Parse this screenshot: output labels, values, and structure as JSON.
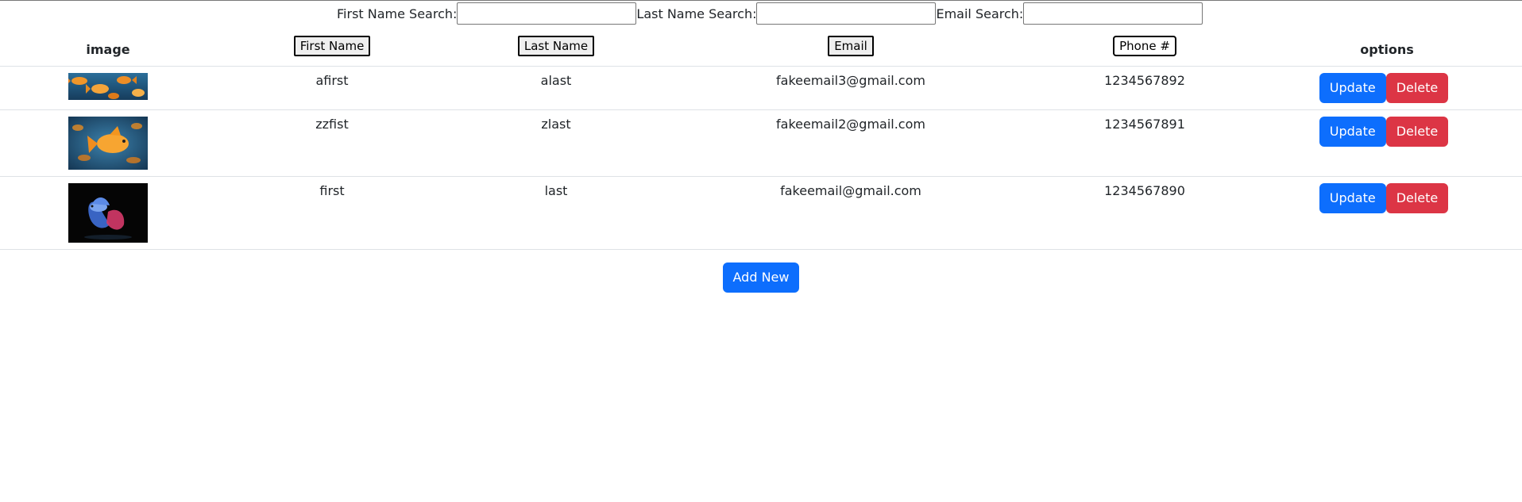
{
  "search": {
    "first_name_label": "First Name Search:",
    "last_name_label": "Last Name Search:",
    "email_label": "Email Search:",
    "first_name_value": "",
    "last_name_value": "",
    "email_value": ""
  },
  "table": {
    "headers": {
      "image": "image",
      "first_name": "First Name",
      "last_name": "Last Name",
      "email": "Email",
      "phone": "Phone #",
      "options": "options"
    },
    "rows": [
      {
        "image": "goldfish-school-photo",
        "first_name": "afirst",
        "last_name": "alast",
        "email": "fakeemail3@gmail.com",
        "phone": "1234567892"
      },
      {
        "image": "goldfish-photo",
        "first_name": "zzfist",
        "last_name": "zlast",
        "email": "fakeemail2@gmail.com",
        "phone": "1234567891"
      },
      {
        "image": "betta-fish-photo",
        "first_name": "first",
        "last_name": "last",
        "email": "fakeemail@gmail.com",
        "phone": "1234567890"
      }
    ],
    "update_label": "Update",
    "delete_label": "Delete"
  },
  "add_new_label": "Add New",
  "colors": {
    "primary": "#0d6efd",
    "danger": "#dc3545",
    "row_border": "#dee2e6"
  }
}
